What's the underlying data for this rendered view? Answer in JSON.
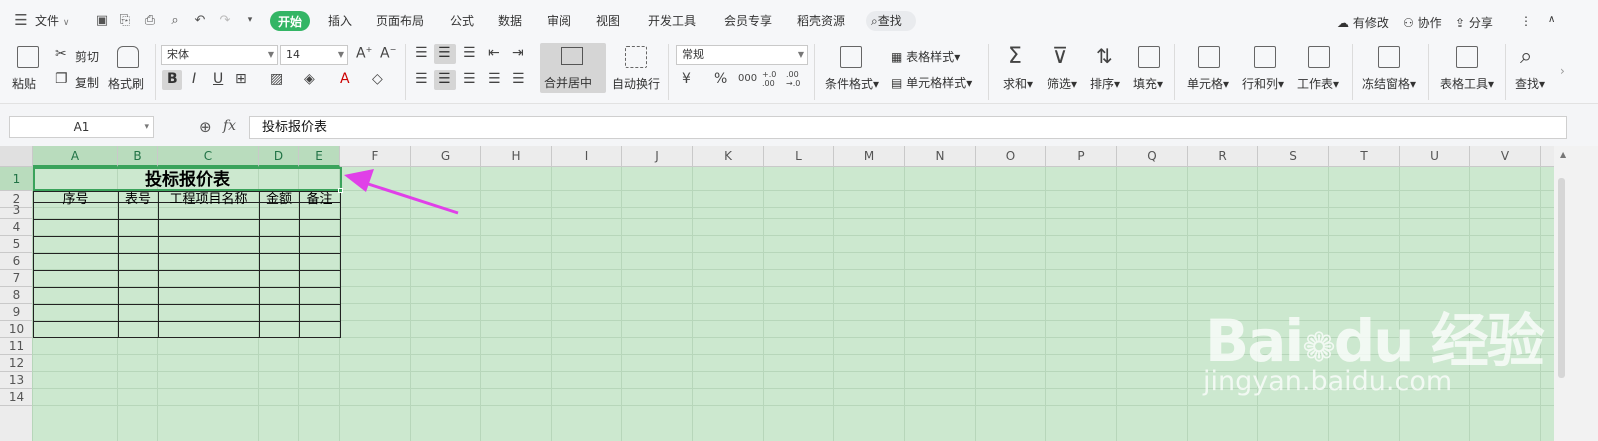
{
  "menubar": {
    "file_label": "文件",
    "tabs": [
      "开始",
      "插入",
      "页面布局",
      "公式",
      "数据",
      "审阅",
      "视图",
      "开发工具",
      "会员专享",
      "稻壳资源"
    ],
    "search_label": "查找",
    "modified_label": "有修改",
    "collab_label": "协作",
    "share_label": "分享"
  },
  "ribbon": {
    "paste": "粘贴",
    "cut": "剪切",
    "copy": "复制",
    "format_painter": "格式刷",
    "font_name": "宋体",
    "font_size": "14",
    "merge_center": "合并居中",
    "auto_wrap": "自动换行",
    "number_format": "常规",
    "cond_format": "条件格式",
    "table_style": "表格样式",
    "cell_style": "单元格样式",
    "sum": "求和",
    "filter": "筛选",
    "sort": "排序",
    "fill": "填充",
    "cell": "单元格",
    "row_col": "行和列",
    "worksheet": "工作表",
    "freeze": "冻结窗格",
    "table_tools": "表格工具",
    "find": "查找",
    "currency_symbol": "¥",
    "percent_symbol": "%",
    "thousands_symbol": "000",
    "inc_decimal": "+.0 .00",
    "dec_decimal": ".00 →.0"
  },
  "formula_bar": {
    "name_box": "A1",
    "fx": "fx",
    "content": "投标报价表"
  },
  "sheet": {
    "columns": [
      "A",
      "B",
      "C",
      "D",
      "E",
      "F",
      "G",
      "H",
      "I",
      "J",
      "K",
      "L",
      "M",
      "N",
      "O",
      "P",
      "Q",
      "R",
      "S",
      "T",
      "U",
      "V"
    ],
    "rows": [
      "1",
      "2",
      "3",
      "4",
      "5",
      "6",
      "7",
      "8",
      "9",
      "10",
      "11",
      "12",
      "13",
      "14"
    ],
    "title": "投标报价表",
    "headers": [
      "序号",
      "表号",
      "工程项目名称",
      "金额",
      "备注"
    ]
  },
  "watermark": {
    "brand": "Bai du 经验",
    "url": "jingyan.baidu.com"
  },
  "colors": {
    "accent": "#33b565",
    "sheet_bg": "#cce8cf",
    "selection": "#3aa35b",
    "arrow": "#e040e8"
  }
}
